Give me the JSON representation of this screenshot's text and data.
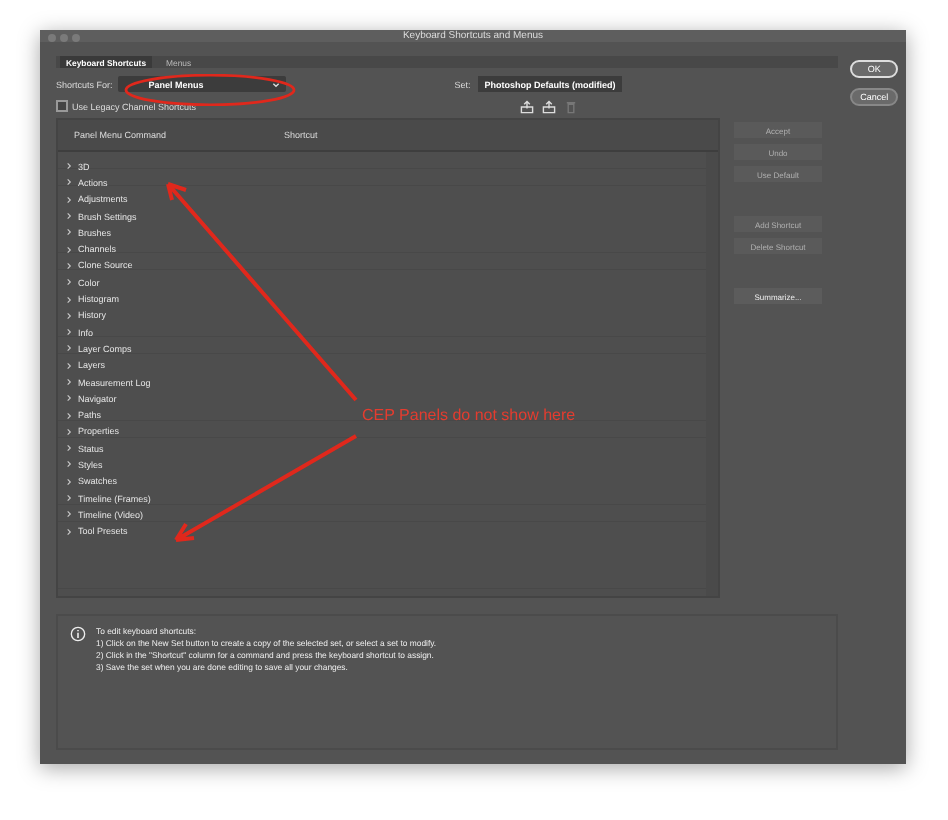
{
  "window": {
    "title": "Keyboard Shortcuts and Menus"
  },
  "tabs": [
    {
      "label": "Keyboard Shortcuts",
      "selected": true
    },
    {
      "label": "Menus",
      "selected": false
    }
  ],
  "shortcuts_for": {
    "label": "Shortcuts For:",
    "value": "Panel Menus"
  },
  "set": {
    "label": "Set:",
    "value": "Photoshop Defaults (modified)"
  },
  "legacy_checkbox": {
    "label": "Use Legacy Channel Shortcuts",
    "checked": false
  },
  "table": {
    "columns": [
      "Panel Menu Command",
      "Shortcut"
    ],
    "rows": [
      {
        "label": "3D",
        "expanded": false
      },
      {
        "label": "Actions",
        "expanded": false
      },
      {
        "label": "Adjustments",
        "expanded": false
      },
      {
        "label": "Brush Settings",
        "expanded": false
      },
      {
        "label": "Brushes",
        "expanded": false
      },
      {
        "label": "Channels",
        "expanded": false
      },
      {
        "label": "Clone Source",
        "expanded": false
      },
      {
        "label": "Color",
        "expanded": false
      },
      {
        "label": "Histogram",
        "expanded": false
      },
      {
        "label": "History",
        "expanded": false
      },
      {
        "label": "Info",
        "expanded": false
      },
      {
        "label": "Layer Comps",
        "expanded": false
      },
      {
        "label": "Layers",
        "expanded": false
      },
      {
        "label": "Measurement Log",
        "expanded": false
      },
      {
        "label": "Navigator",
        "expanded": false
      },
      {
        "label": "Paths",
        "expanded": false
      },
      {
        "label": "Properties",
        "expanded": false
      },
      {
        "label": "Status",
        "expanded": false
      },
      {
        "label": "Styles",
        "expanded": false
      },
      {
        "label": "Swatches",
        "expanded": false
      },
      {
        "label": "Timeline (Frames)",
        "expanded": false
      },
      {
        "label": "Timeline (Video)",
        "expanded": false
      },
      {
        "label": "Tool Presets",
        "expanded": false
      }
    ]
  },
  "side_buttons": [
    {
      "label": "Accept",
      "disabled": true
    },
    {
      "label": "Undo",
      "disabled": true
    },
    {
      "label": "Use Default",
      "disabled": true
    },
    {
      "label": "Add Shortcut",
      "disabled": true
    },
    {
      "label": "Delete Shortcut",
      "disabled": true
    },
    {
      "label": "Summarize...",
      "disabled": false
    }
  ],
  "dialog_buttons": [
    "OK",
    "Cancel"
  ],
  "info": [
    "To edit keyboard shortcuts:",
    "1) Click on the New Set button to create a copy of the selected set, or select a set to modify.",
    "2) Click in the \"Shortcut\" column for a command and press the keyboard shortcut to assign.",
    "3) Save the set when you are done editing to save all your changes."
  ],
  "annotation": {
    "text": "CEP Panels do not show here"
  }
}
